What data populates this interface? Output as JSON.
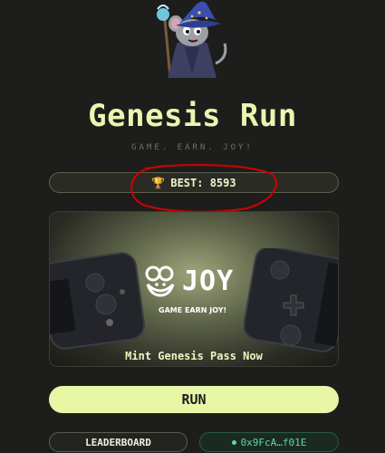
{
  "header": {
    "title": "Genesis Run",
    "subtitle": "GAME. EARN. JOY!"
  },
  "best_score": {
    "label": "BEST: 8593",
    "icon": "trophy-icon"
  },
  "promo": {
    "logo_text": "JOY",
    "tagline": "GAME EARN JOY!",
    "cta": "Mint Genesis Pass Now"
  },
  "actions": {
    "run_label": "RUN",
    "leaderboard_label": "LEADERBOARD",
    "wallet_label": "0x9FcA…f01E"
  },
  "colors": {
    "background": "#1d1e1c",
    "accent": "#e7f7a6",
    "wallet": "#5fd8a2",
    "annotation": "#d10000"
  }
}
